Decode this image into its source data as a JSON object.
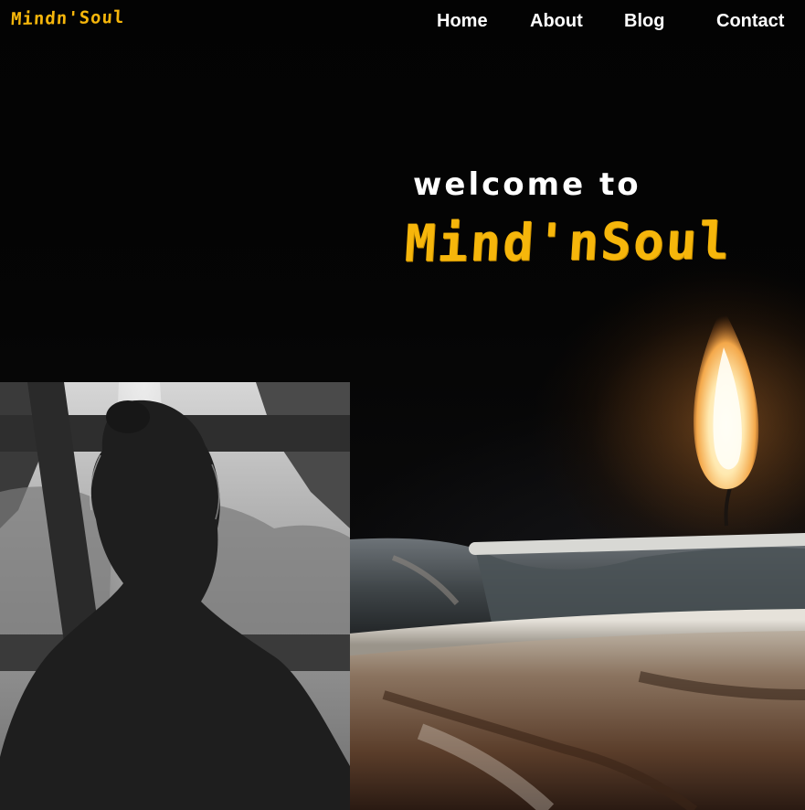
{
  "header": {
    "logo": "Mindn'Soul",
    "nav": [
      {
        "label": "Home"
      },
      {
        "label": "About"
      },
      {
        "label": "Blog"
      },
      {
        "label": "Contact"
      }
    ]
  },
  "hero": {
    "subtitle": "welcome to",
    "title": "Mind'nSoul"
  },
  "colors": {
    "accent": "#f6b60b",
    "background": "#000000",
    "nav_text": "#ffffff"
  }
}
